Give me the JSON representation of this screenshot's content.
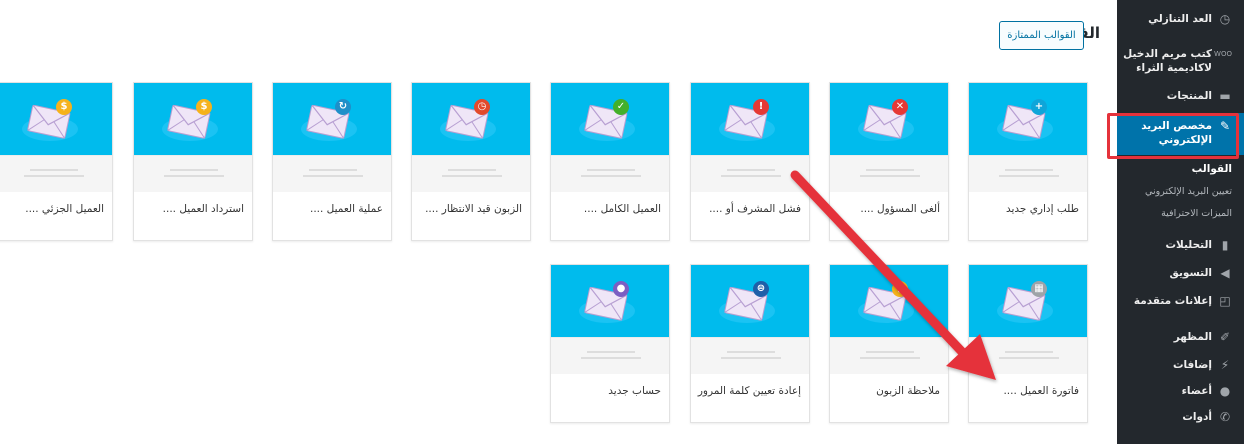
{
  "page": {
    "title": "القوالب",
    "premium_button": "القوالب الممتازة"
  },
  "cards": [
    {
      "label": "طلب إداري جديد",
      "badge_icon": "+",
      "badge_color": "#0ea5d9"
    },
    {
      "label": "ألغى المسؤول ....",
      "badge_icon": "✕",
      "badge_color": "#e53935"
    },
    {
      "label": "فشل المشرف أو ....",
      "badge_icon": "!",
      "badge_color": "#e53935"
    },
    {
      "label": "العميل الكامل ....",
      "badge_icon": "✓",
      "badge_color": "#43b02a"
    },
    {
      "label": "الزبون قيد الانتظار ....",
      "badge_icon": "◷",
      "badge_color": "#e24a2b"
    },
    {
      "label": "عملية العميل ....",
      "badge_icon": "↻",
      "badge_color": "#1f8fc9"
    },
    {
      "label": "استرداد العميل ....",
      "badge_icon": "$",
      "badge_color": "#f5b21b"
    },
    {
      "label": "العميل الجزئي ....",
      "badge_icon": "$",
      "badge_color": "#f5b21b"
    },
    {
      "label": "فاتورة العميل ....",
      "badge_icon": "▦",
      "badge_color": "#9ea3a8"
    },
    {
      "label": "ملاحظة الزبون",
      "badge_icon": "▮",
      "badge_color": "#f5b21b"
    },
    {
      "label": "إعادة تعيين كلمة المرور",
      "badge_icon": "⊜",
      "badge_color": "#1f5fa8"
    },
    {
      "label": "حساب جديد",
      "badge_icon": "●",
      "badge_color": "#7b5fc2"
    }
  ],
  "sidebar": {
    "items": [
      {
        "label": "العد التنازلي",
        "icon": "clock-icon"
      },
      {
        "label": "كتب مريم الدخيل لاكاديمية الثراء",
        "icon": "woo-icon"
      },
      {
        "label": "المنتجات",
        "icon": "archive-icon"
      },
      {
        "label": "مخصص البريد الإلكتروني",
        "icon": "brush-icon"
      },
      {
        "label": "التحليلات",
        "icon": "chart-icon"
      },
      {
        "label": "التسويق",
        "icon": "megaphone-icon"
      },
      {
        "label": "إعلانات متقدمة",
        "icon": "ads-icon"
      },
      {
        "label": "المظهر",
        "icon": "appearance-icon"
      },
      {
        "label": "إضافات",
        "icon": "plugin-icon"
      },
      {
        "label": "أعضاء",
        "icon": "user-icon"
      },
      {
        "label": "أدوات",
        "icon": "wrench-icon"
      }
    ],
    "submenu": [
      {
        "label": "القوالب"
      },
      {
        "label": "تعيين البريد الإلكتروني"
      },
      {
        "label": "الميزات الاحترافية"
      }
    ]
  },
  "colors": {
    "card_header": "#00bbed",
    "sidebar_bg": "#23282d",
    "active_menu": "#0073aa",
    "annotation": "#e5323b"
  }
}
